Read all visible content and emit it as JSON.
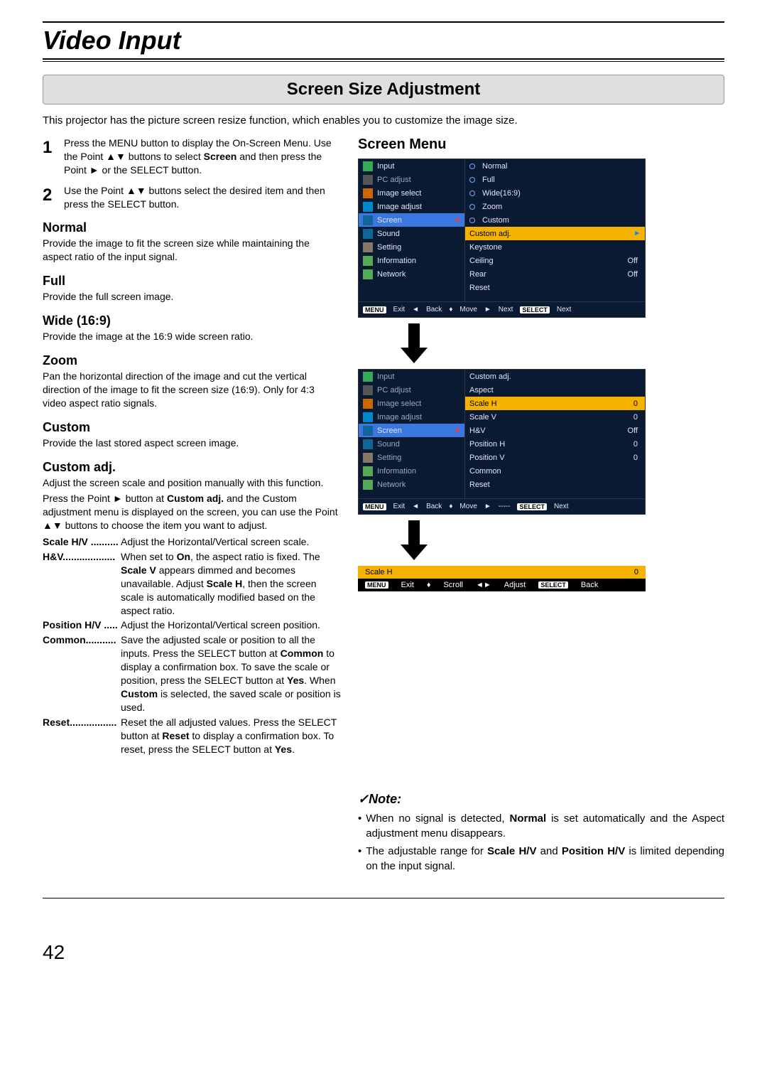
{
  "pageTitle": "Video Input",
  "sectionHead": "Screen Size Adjustment",
  "intro": "This projector has the picture screen resize function, which enables you to customize the image size.",
  "step1_num": "1",
  "step1_text_a": "Press the MENU button to display the On-Screen Menu. Use the Point ▲▼ buttons to select ",
  "step1_bold": "Screen",
  "step1_text_b": " and then press the Point ► or the SELECT button.",
  "step2_num": "2",
  "step2_text": "Use the Point ▲▼ buttons select the desired item and then press the SELECT button.",
  "h_normal": "Normal",
  "d_normal": "Provide the image to fit the screen size while maintaining the aspect ratio of the input signal.",
  "h_full": "Full",
  "d_full": "Provide the full screen image.",
  "h_wide": "Wide (16:9)",
  "d_wide": "Provide the image at the 16:9 wide screen ratio.",
  "h_zoom": "Zoom",
  "d_zoom": "Pan the horizontal direction of the image and cut the vertical direction of the image to fit the screen size (16:9). Only for 4:3 video aspect ratio signals.",
  "h_custom": "Custom",
  "d_custom": "Provide the last stored aspect screen image.",
  "h_custadj": "Custom adj.",
  "d_custadj1": "Adjust the screen scale and position manually with this function.",
  "d_custadj2_a": "Press the Point ► button at ",
  "d_custadj2_bold": "Custom adj.",
  "d_custadj2_b": " and the Custom adjustment menu is displayed on the screen, you can use the Point ▲▼ buttons to choose the item you want to adjust.",
  "p_scalehv_l": "Scale H/V",
  "p_scalehv_t": "Adjust the Horizontal/Vertical screen scale.",
  "p_hv_l": "H&V",
  "p_hv_t_a": "When set to ",
  "p_hv_t_on": "On",
  "p_hv_t_b": ", the aspect ratio is fixed. The ",
  "p_hv_t_sv": "Scale V",
  "p_hv_t_c": " appears dimmed and becomes unavailable. Adjust ",
  "p_hv_t_sh": "Scale H",
  "p_hv_t_d": ", then the screen scale is automatically modified based on the aspect ratio.",
  "p_poshv_l": "Position H/V",
  "p_poshv_t": "Adjust the Horizontal/Vertical screen position.",
  "p_common_l": "Common",
  "p_common_t_a": "Save the adjusted scale or position to all the inputs. Press the SELECT button at ",
  "p_common_t_b": "Common",
  "p_common_t_c": " to display a confirmation box. To save the scale or position, press the SELECT button at ",
  "p_common_t_d": "Yes",
  "p_common_t_e": ". When ",
  "p_common_t_f": "Custom",
  "p_common_t_g": " is selected, the saved scale or position is used.",
  "p_reset_l": "Reset",
  "p_reset_t_a": "Reset the all adjusted values. Press the SELECT button at ",
  "p_reset_t_b": "Reset",
  "p_reset_t_c": " to display a confirmation box. To reset, press the SELECT button at ",
  "p_reset_t_d": "Yes",
  "p_reset_t_e": ".",
  "screenMenuHead": "Screen Menu",
  "menuLeft": {
    "input": "Input",
    "pc": "PC adjust",
    "imgsel": "Image select",
    "imgadj": "Image adjust",
    "screen": "Screen",
    "sound": "Sound",
    "setting": "Setting",
    "info": "Information",
    "net": "Network"
  },
  "screenMenuR": {
    "normal": "Normal",
    "full": "Full",
    "wide": "Wide(16:9)",
    "zoom": "Zoom",
    "custom": "Custom",
    "custadj": "Custom adj.",
    "keystone": "Keystone",
    "ceiling": "Ceiling",
    "ceiling_v": "Off",
    "rear": "Rear",
    "rear_v": "Off",
    "reset": "Reset"
  },
  "footer": {
    "menu": "MENU",
    "exit": "Exit",
    "back": "Back",
    "move": "Move",
    "next": "Next",
    "select": "SELECT",
    "next2": "Next"
  },
  "custMenuR": {
    "title": "Custom adj.",
    "aspect": "Aspect",
    "scaleh": "Scale H",
    "scaleh_v": "0",
    "scalev": "Scale V",
    "scalev_v": "0",
    "hv": "H&V",
    "hv_v": "Off",
    "posH": "Position H",
    "posH_v": "0",
    "posV": "Position V",
    "posV_v": "0",
    "common": "Common",
    "reset": "Reset"
  },
  "custFooterDots": "-----",
  "miniBar": {
    "label": "Scale H",
    "val": "0",
    "menu": "MENU",
    "exit": "Exit",
    "scroll": "Scroll",
    "adjust": "Adjust",
    "select": "SELECT",
    "back": "Back"
  },
  "noteHead": "✓Note:",
  "note1_a": "When no signal is detected, ",
  "note1_b": "Normal",
  "note1_c": " is set automatically and the Aspect adjustment menu disappears.",
  "note2_a": "The adjustable range for ",
  "note2_b": "Scale H/V",
  "note2_c": " and ",
  "note2_d": "Position H/V",
  "note2_e": " is limited depending on the input signal.",
  "pageNum": "42",
  "dots": {
    "d1": " ..........",
    "d2": "...................",
    "d3": " .....",
    "d4": "...........",
    "d5": "................."
  },
  "arrows": {
    "back": "◄",
    "updown": "♦",
    "right": "►",
    "lr": "◄►",
    "scroll": "♦"
  }
}
